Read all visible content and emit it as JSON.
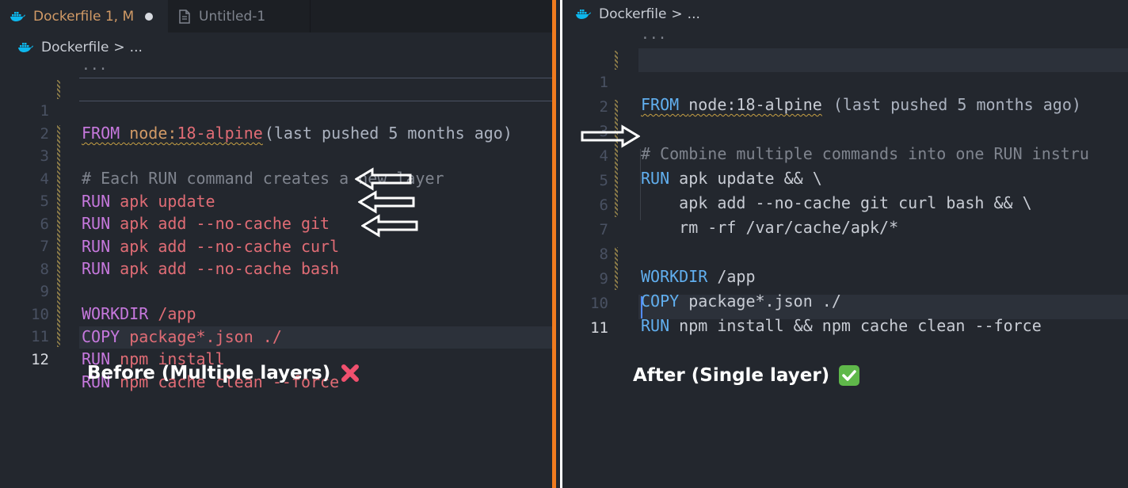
{
  "tabs": [
    {
      "label": "Dockerfile 1, M",
      "icon": "docker-icon",
      "active": true,
      "modified": true
    },
    {
      "label": "Untitled-1",
      "icon": "file-icon",
      "active": false
    }
  ],
  "breadcrumb": {
    "file": "Dockerfile",
    "separator": ">",
    "more": "..."
  },
  "before": {
    "caption": "Before (Multiple layers)",
    "caption_icon": "cross-mark-icon",
    "fold_ellipsis": "...",
    "lines": [
      {
        "n": "1",
        "text": "FROM node:18-alpine",
        "hint": "(last pushed 5 months ago)"
      },
      {
        "n": "2",
        "text": ""
      },
      {
        "n": "3",
        "text": "# Each RUN command creates a new layer"
      },
      {
        "n": "4",
        "text": "RUN apk update"
      },
      {
        "n": "5",
        "text": "RUN apk add --no-cache git"
      },
      {
        "n": "6",
        "text": "RUN apk add --no-cache curl"
      },
      {
        "n": "7",
        "text": "RUN apk add --no-cache bash"
      },
      {
        "n": "8",
        "text": ""
      },
      {
        "n": "9",
        "text": "WORKDIR /app"
      },
      {
        "n": "10",
        "text": "COPY package*.json ./"
      },
      {
        "n": "11",
        "text": "RUN npm install"
      },
      {
        "n": "12",
        "text": "RUN npm cache clean --force"
      }
    ]
  },
  "after": {
    "caption": "After (Single layer)",
    "caption_icon": "check-mark-icon",
    "fold_ellipsis": "...",
    "lines": [
      {
        "n": "1",
        "text": "FROM node:18-alpine",
        "hint": "(last pushed 5 months ago)"
      },
      {
        "n": "2",
        "text": ""
      },
      {
        "n": "3",
        "text": "# Combine multiple commands into one RUN instru"
      },
      {
        "n": "4",
        "text": "RUN apk update && \\"
      },
      {
        "n": "5",
        "text": "    apk add --no-cache git curl bash && \\"
      },
      {
        "n": "6",
        "text": "    rm -rf /var/cache/apk/*"
      },
      {
        "n": "7",
        "text": ""
      },
      {
        "n": "8",
        "text": "WORKDIR /app"
      },
      {
        "n": "9",
        "text": "COPY package*.json ./"
      },
      {
        "n": "10",
        "text": "RUN npm install && npm cache clean --force"
      },
      {
        "n": "11",
        "text": ""
      }
    ]
  },
  "colors": {
    "divider": "#f07b1f",
    "keyword": "#c678dd",
    "keyword_after": "#61afef",
    "red": "#e06c75",
    "background": "#23272e"
  }
}
